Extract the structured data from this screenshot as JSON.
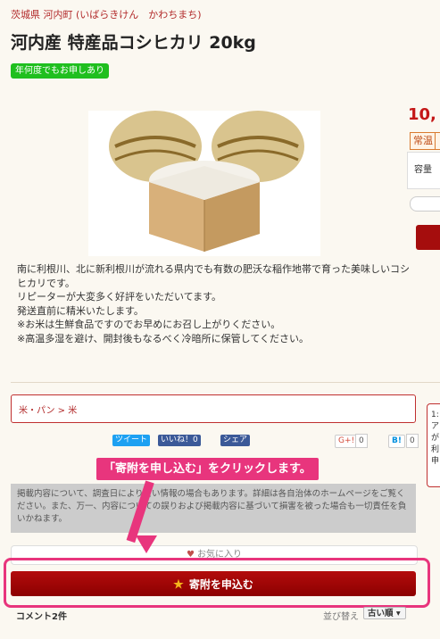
{
  "breadcrumb": {
    "prefecture_line": "茨城県 河内町 (いばらきけん　かわちまち)"
  },
  "product": {
    "title": "河内産 特産品コシヒカリ 20kg",
    "badge": "年何度でもお申しあり",
    "description": [
      "南に利根川、北に新利根川が流れる県内でも有数の肥沃な稲作地帯で育った美味しいコシヒカリです。",
      "リピーターが大変多く好評をいただいてます。",
      "発送直前に精米いたします。",
      "※お米は生鮮食品ですのでお早めにお召し上がりください。",
      "※高温多湿を避け、開封後もなるべく冷暗所に保管してください。"
    ]
  },
  "sidebar": {
    "price_partial": "10,",
    "temperature_label": "常温",
    "capacity_label": "容量",
    "tip_partial": "1: ア が 利 申"
  },
  "category": {
    "path": "米・パン > 米"
  },
  "share": {
    "twitter": "ツイート",
    "facebook_like": "いいね！0",
    "facebook_share": "シェア",
    "google_plus": "G+!",
    "google_count": "0",
    "hatena": "B!",
    "hatena_count": "0"
  },
  "annotation": {
    "text": "「寄附を申し込む」をクリックします。"
  },
  "disclaimer": "掲載内容について、調査日により古い情報の場合もあります。詳細は各自治体のホームページをご覧ください。また、万一、内容についての誤りおよび掲載内容に基づいて損害を被った場合も一切責任を負いかねます。",
  "actions": {
    "favorite_label": "お気に入り",
    "donate_label": "寄附を申込む"
  },
  "comments": {
    "count_label": "コメント2件",
    "sort_label": "並び替え",
    "sort_value": "古い順"
  },
  "colors": {
    "accent_red": "#a50d0d",
    "highlight_pink": "#e8357d",
    "badge_green": "#1fbf1f"
  }
}
